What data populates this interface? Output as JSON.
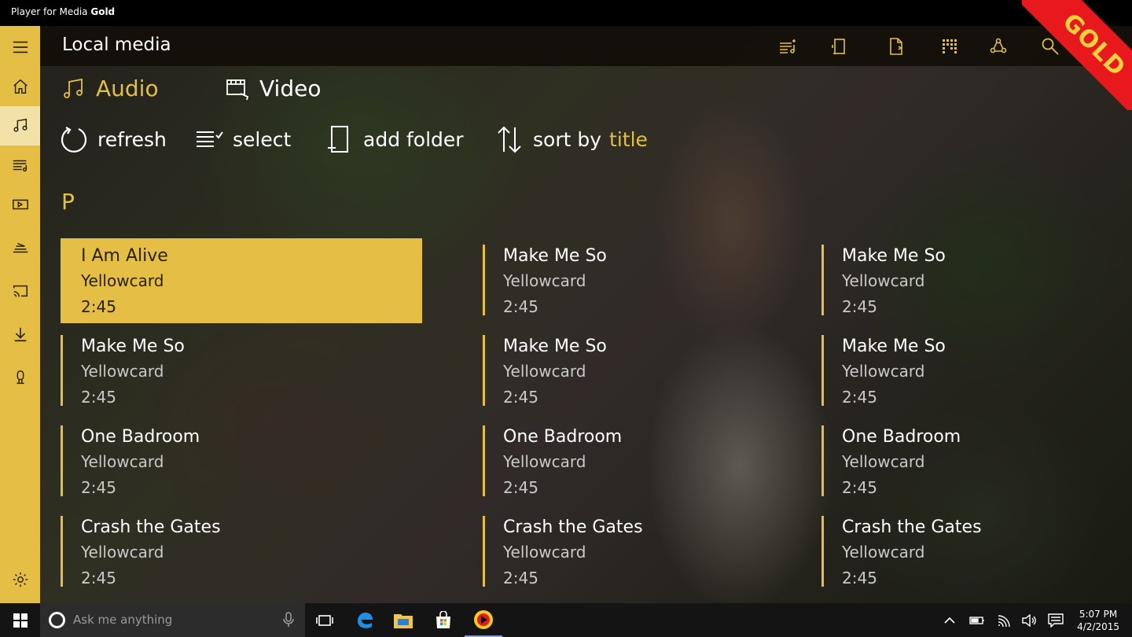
{
  "window": {
    "title_prefix": "Player for Media",
    "title_suffix": "Gold"
  },
  "badge": {
    "label": "GOLD"
  },
  "header": {
    "title": "Local media"
  },
  "header_icons": [
    "now-playing-list-icon",
    "phone-device-icon",
    "file-open-icon",
    "equalizer-icon",
    "media-share-icon",
    "search-icon"
  ],
  "sidebar": {
    "items": [
      {
        "icon": "hamburger-menu-icon"
      },
      {
        "icon": "home-icon"
      },
      {
        "icon": "music-note-icon",
        "active": true
      },
      {
        "icon": "playlist-icon"
      },
      {
        "icon": "video-tape-icon"
      },
      {
        "icon": "network-icon"
      },
      {
        "icon": "cast-icon"
      },
      {
        "icon": "download-icon"
      },
      {
        "icon": "podcast-icon"
      }
    ],
    "settings_icon": "gear-icon"
  },
  "tabs": [
    {
      "label": "Audio",
      "icon": "music-notes-icon",
      "active": true
    },
    {
      "label": "Video",
      "icon": "film-icon",
      "active": false
    }
  ],
  "toolbar": {
    "refresh": "refresh",
    "select": "select",
    "add_folder": "add folder",
    "sort_by": "sort by",
    "sort_value": "title"
  },
  "group_letter": "P",
  "tracks": [
    [
      {
        "title": "I Am Alive",
        "artist": "Yellowcard",
        "duration": "2:45",
        "selected": true
      },
      {
        "title": "Make Me So",
        "artist": "Yellowcard",
        "duration": "2:45"
      },
      {
        "title": "One Badroom",
        "artist": "Yellowcard",
        "duration": "2:45"
      },
      {
        "title": "Crash the Gates",
        "artist": "Yellowcard",
        "duration": "2:45"
      }
    ],
    [
      {
        "title": "Make Me So",
        "artist": "Yellowcard",
        "duration": "2:45"
      },
      {
        "title": "Make Me So",
        "artist": "Yellowcard",
        "duration": "2:45"
      },
      {
        "title": "One Badroom",
        "artist": "Yellowcard",
        "duration": "2:45"
      },
      {
        "title": "Crash the Gates",
        "artist": "Yellowcard",
        "duration": "2:45"
      }
    ],
    [
      {
        "title": "Make Me So",
        "artist": "Yellowcard",
        "duration": "2:45"
      },
      {
        "title": "Make Me So",
        "artist": "Yellowcard",
        "duration": "2:45"
      },
      {
        "title": "One Badroom",
        "artist": "Yellowcard",
        "duration": "2:45"
      },
      {
        "title": "Crash the Gates",
        "artist": "Yellowcard",
        "duration": "2:45"
      }
    ]
  ],
  "taskbar": {
    "search_placeholder": "Ask me anything",
    "time": "5:07 PM",
    "date": "4/2/2015"
  },
  "colors": {
    "accent": "#e5be45",
    "ribbon": "#e8191c",
    "selected_text": "#2a2208"
  }
}
